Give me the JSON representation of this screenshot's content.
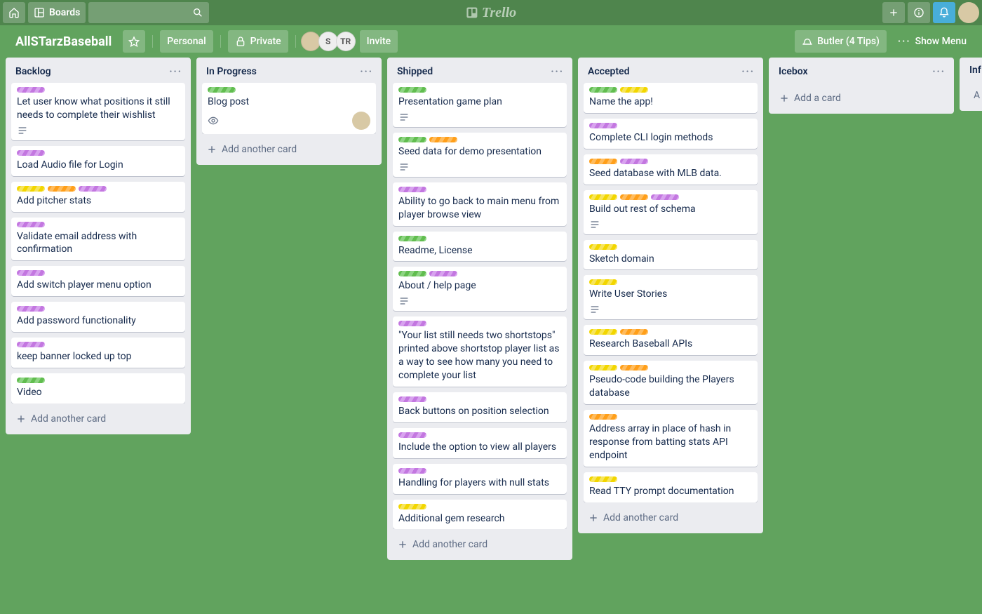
{
  "topbar": {
    "boards_label": "Boards",
    "logo_text": "Trello"
  },
  "board_header": {
    "title": "AllSTarzBaseball",
    "personal_label": "Personal",
    "private_label": "Private",
    "invite_label": "Invite",
    "butler_label": "Butler (4 Tips)",
    "show_menu_label": "Show Menu",
    "members": [
      {
        "initials": ""
      },
      {
        "initials": "S"
      },
      {
        "initials": "TR"
      }
    ]
  },
  "strings": {
    "add_another_card": "Add another card",
    "add_a_card": "Add a card"
  },
  "lists": [
    {
      "title": "Backlog",
      "cards": [
        {
          "labels": [
            "purple"
          ],
          "title": "Let user know what positions it still needs to complete their wishlist",
          "has_desc": true
        },
        {
          "labels": [
            "purple"
          ],
          "title": "Load Audio file for Login"
        },
        {
          "labels": [
            "yellow",
            "orange",
            "purple"
          ],
          "title": "Add pitcher stats"
        },
        {
          "labels": [
            "purple"
          ],
          "title": "Validate email address with confirmation"
        },
        {
          "labels": [
            "purple"
          ],
          "title": "Add switch player menu option"
        },
        {
          "labels": [
            "purple"
          ],
          "title": "Add password functionality"
        },
        {
          "labels": [
            "purple"
          ],
          "title": "keep banner locked up top"
        },
        {
          "labels": [
            "green"
          ],
          "title": "Video"
        }
      ],
      "footer_key": "add_another_card"
    },
    {
      "title": "In Progress",
      "cards": [
        {
          "labels": [
            "green"
          ],
          "title": "Blog post",
          "has_watch": true,
          "has_member": true
        }
      ],
      "footer_key": "add_another_card"
    },
    {
      "title": "Shipped",
      "scroll": true,
      "cards": [
        {
          "labels": [
            "green"
          ],
          "title": "Presentation game plan",
          "has_desc": true
        },
        {
          "labels": [
            "green",
            "orange"
          ],
          "title": "Seed data for demo presentation",
          "has_desc": true
        },
        {
          "labels": [
            "purple"
          ],
          "title": "Ability to go back to main menu from player browse view"
        },
        {
          "labels": [
            "green"
          ],
          "title": "Readme, License"
        },
        {
          "labels": [
            "green",
            "purple"
          ],
          "title": "About / help page",
          "has_desc": true
        },
        {
          "labels": [
            "purple"
          ],
          "title": "\"Your list still needs two shortstops\" printed above shortstop player list as a way to see how many you need to complete your list"
        },
        {
          "labels": [
            "purple"
          ],
          "title": "Back buttons on position selection"
        },
        {
          "labels": [
            "purple"
          ],
          "title": "Include the option to view all players"
        },
        {
          "labels": [
            "purple"
          ],
          "title": "Handling for players with null stats"
        },
        {
          "labels": [
            "yellow"
          ],
          "title": "Additional gem research"
        }
      ],
      "footer_key": "add_another_card"
    },
    {
      "title": "Accepted",
      "cards": [
        {
          "labels": [
            "green",
            "yellow"
          ],
          "title": "Name the app!"
        },
        {
          "labels": [
            "purple"
          ],
          "title": "Complete CLI login methods"
        },
        {
          "labels": [
            "orange",
            "purple"
          ],
          "title": "Seed database with MLB data."
        },
        {
          "labels": [
            "yellow",
            "orange",
            "purple"
          ],
          "title": "Build out rest of schema",
          "has_desc": true
        },
        {
          "labels": [
            "yellow"
          ],
          "title": "Sketch domain"
        },
        {
          "labels": [
            "yellow"
          ],
          "title": "Write User Stories",
          "has_desc": true
        },
        {
          "labels": [
            "yellow",
            "orange"
          ],
          "title": "Research Baseball APIs"
        },
        {
          "labels": [
            "yellow",
            "orange"
          ],
          "title": "Pseudo-code building the Players database"
        },
        {
          "labels": [
            "orange"
          ],
          "title": "Address array in place of hash in response from batting stats API endpoint"
        },
        {
          "labels": [
            "yellow"
          ],
          "title": "Read TTY prompt documentation"
        }
      ],
      "footer_key": "add_another_card"
    },
    {
      "title": "Icebox",
      "cards": [],
      "footer_key": "add_a_card"
    },
    {
      "title": "Inf",
      "partial": true,
      "cards": [],
      "footer_key": "add_a_card",
      "footer_text_only_plus": true
    }
  ]
}
